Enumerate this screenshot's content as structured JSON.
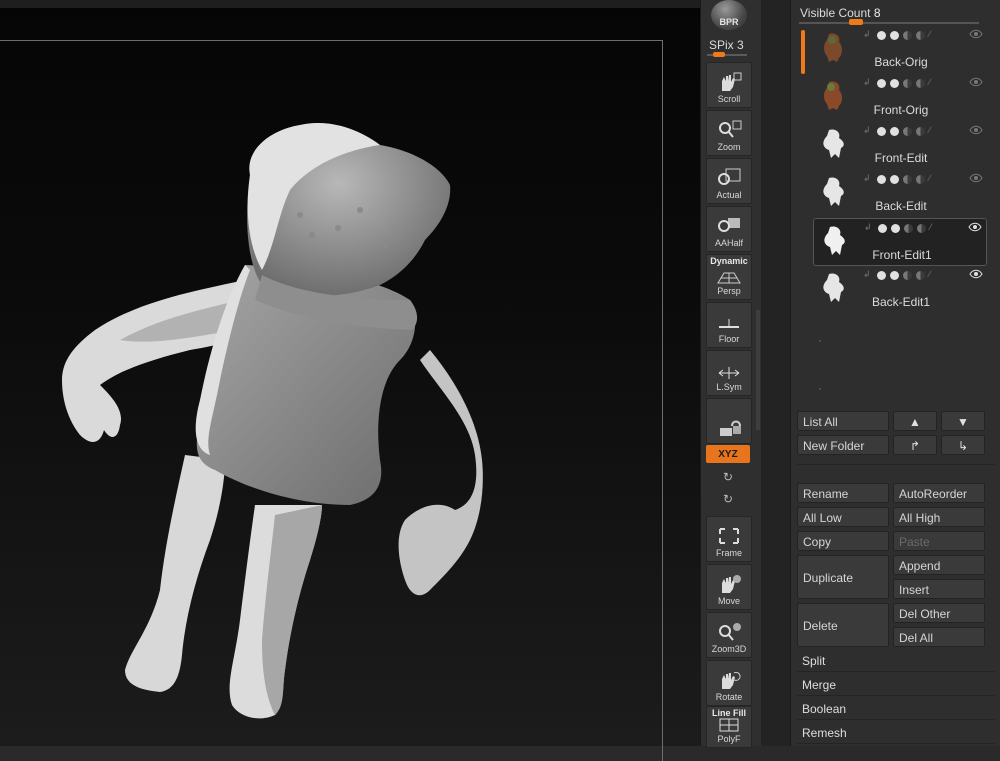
{
  "shelf": {
    "bpr_label": "BPR",
    "spix_label": "SPix 3",
    "tools": [
      {
        "label": "Scroll",
        "icon": "scroll-hand-icon"
      },
      {
        "label": "Zoom",
        "icon": "zoom-magnifier-icon"
      },
      {
        "label": "Actual",
        "icon": "actual-size-icon"
      },
      {
        "label": "AAHalf",
        "icon": "aahalf-icon"
      },
      {
        "label": "Persp",
        "top_label": "Dynamic",
        "icon": "perspective-grid-icon"
      },
      {
        "label": "Floor",
        "icon": "floor-grid-icon"
      },
      {
        "label": "L.Sym",
        "icon": "local-symmetry-icon"
      },
      {
        "label": "",
        "icon": "lock-camera-icon"
      },
      {
        "label": "Frame",
        "icon": "frame-icon"
      },
      {
        "label": "Move",
        "icon": "move-hand-icon"
      },
      {
        "label": "Zoom3D",
        "icon": "zoom3d-icon"
      },
      {
        "label": "Rotate",
        "icon": "rotate-icon"
      },
      {
        "label": "PolyF",
        "top_label": "Line Fill",
        "icon": "polyframe-icon"
      }
    ],
    "xyz_label": "XYZ",
    "accent_color": "#e8741c"
  },
  "subtool": {
    "visible_count_label": "Visible Count",
    "visible_count_value": "8",
    "items": [
      {
        "name": "Back-Orig",
        "thumb": "color"
      },
      {
        "name": "Front-Orig",
        "thumb": "color"
      },
      {
        "name": "Front-Edit",
        "thumb": "white"
      },
      {
        "name": "Back-Edit",
        "thumb": "white"
      },
      {
        "name": "Front-Edit1",
        "thumb": "white",
        "selected": true
      },
      {
        "name": "Back-Edit1",
        "thumb": "white"
      }
    ],
    "buttons": {
      "list_all": "List All",
      "new_folder": "New Folder",
      "rename": "Rename",
      "auto_reorder": "AutoReorder",
      "all_low": "All Low",
      "all_high": "All High",
      "copy": "Copy",
      "paste": "Paste",
      "duplicate": "Duplicate",
      "append": "Append",
      "insert": "Insert",
      "delete": "Delete",
      "del_other": "Del Other",
      "del_all": "Del All"
    },
    "sections": [
      "Split",
      "Merge",
      "Boolean",
      "Remesh"
    ]
  }
}
